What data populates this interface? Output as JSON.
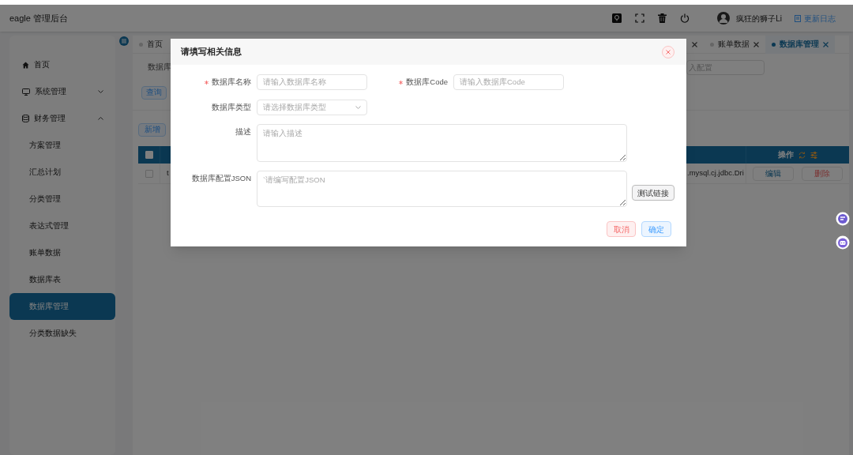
{
  "app_title": "eagle 管理后台",
  "header": {
    "user_name": "疯狂的狮子Li",
    "changelog_link": "更新日志"
  },
  "sidebar": {
    "items": [
      {
        "label": "首页",
        "selected": false
      },
      {
        "label": "系统管理",
        "expanded": false,
        "selected": false
      },
      {
        "label": "财务管理",
        "expanded": true,
        "selected": false,
        "children": [
          {
            "label": "方案管理",
            "selected": false
          },
          {
            "label": "汇总计划",
            "selected": false
          },
          {
            "label": "分类管理",
            "selected": false
          },
          {
            "label": "表达式管理",
            "selected": false
          },
          {
            "label": "账单数据",
            "selected": false
          },
          {
            "label": "数据库表",
            "selected": false
          },
          {
            "label": "数据库管理",
            "selected": true
          },
          {
            "label": "分类数据缺失",
            "selected": false
          }
        ]
      }
    ]
  },
  "tabs": [
    {
      "label": "首页",
      "selected": false
    },
    {
      "selected": false,
      "closable": true
    },
    {
      "label": "账单数据",
      "selected": false,
      "closable": true
    },
    {
      "label": "数据库管理",
      "selected": true,
      "closable": true
    }
  ],
  "search": {
    "label": "数据库",
    "field_placeholder": "入配置",
    "query_button": "查询"
  },
  "add_button": "新增",
  "table": {
    "columns": [
      {
        "kind": "checkbox",
        "checked": false
      },
      {
        "kind": "hidden"
      },
      {
        "kind": "hidden"
      },
      {
        "kind": "actions",
        "label": "操作"
      }
    ],
    "rows": [
      {
        "checked": false,
        "cells": [
          "t",
          ".mysql.cj.jdbc.Dri"
        ],
        "actions": [
          "编辑",
          "删除"
        ]
      }
    ]
  },
  "dialog": {
    "title": "请填写相关信息",
    "fields": [
      {
        "label": "数据库名称",
        "required": true,
        "kind": "input",
        "placeholder": "请输入数据库名称"
      },
      {
        "label": "数据库Code",
        "required": true,
        "kind": "input",
        "placeholder": "请输入数据库Code"
      },
      {
        "label": "数据库类型",
        "required": false,
        "kind": "select",
        "placeholder": "请选择数据库类型"
      },
      {
        "label": "描述",
        "required": false,
        "kind": "textarea",
        "placeholder": "请输入描述"
      },
      {
        "label": "数据库配置JSON",
        "required": false,
        "kind": "textarea",
        "placeholder": "`请编写配置JSON"
      }
    ],
    "test_button": "测试链接",
    "buttons": [
      {
        "label": "取消",
        "kind": "danger"
      },
      {
        "label": "确定",
        "kind": "primary"
      }
    ]
  }
}
